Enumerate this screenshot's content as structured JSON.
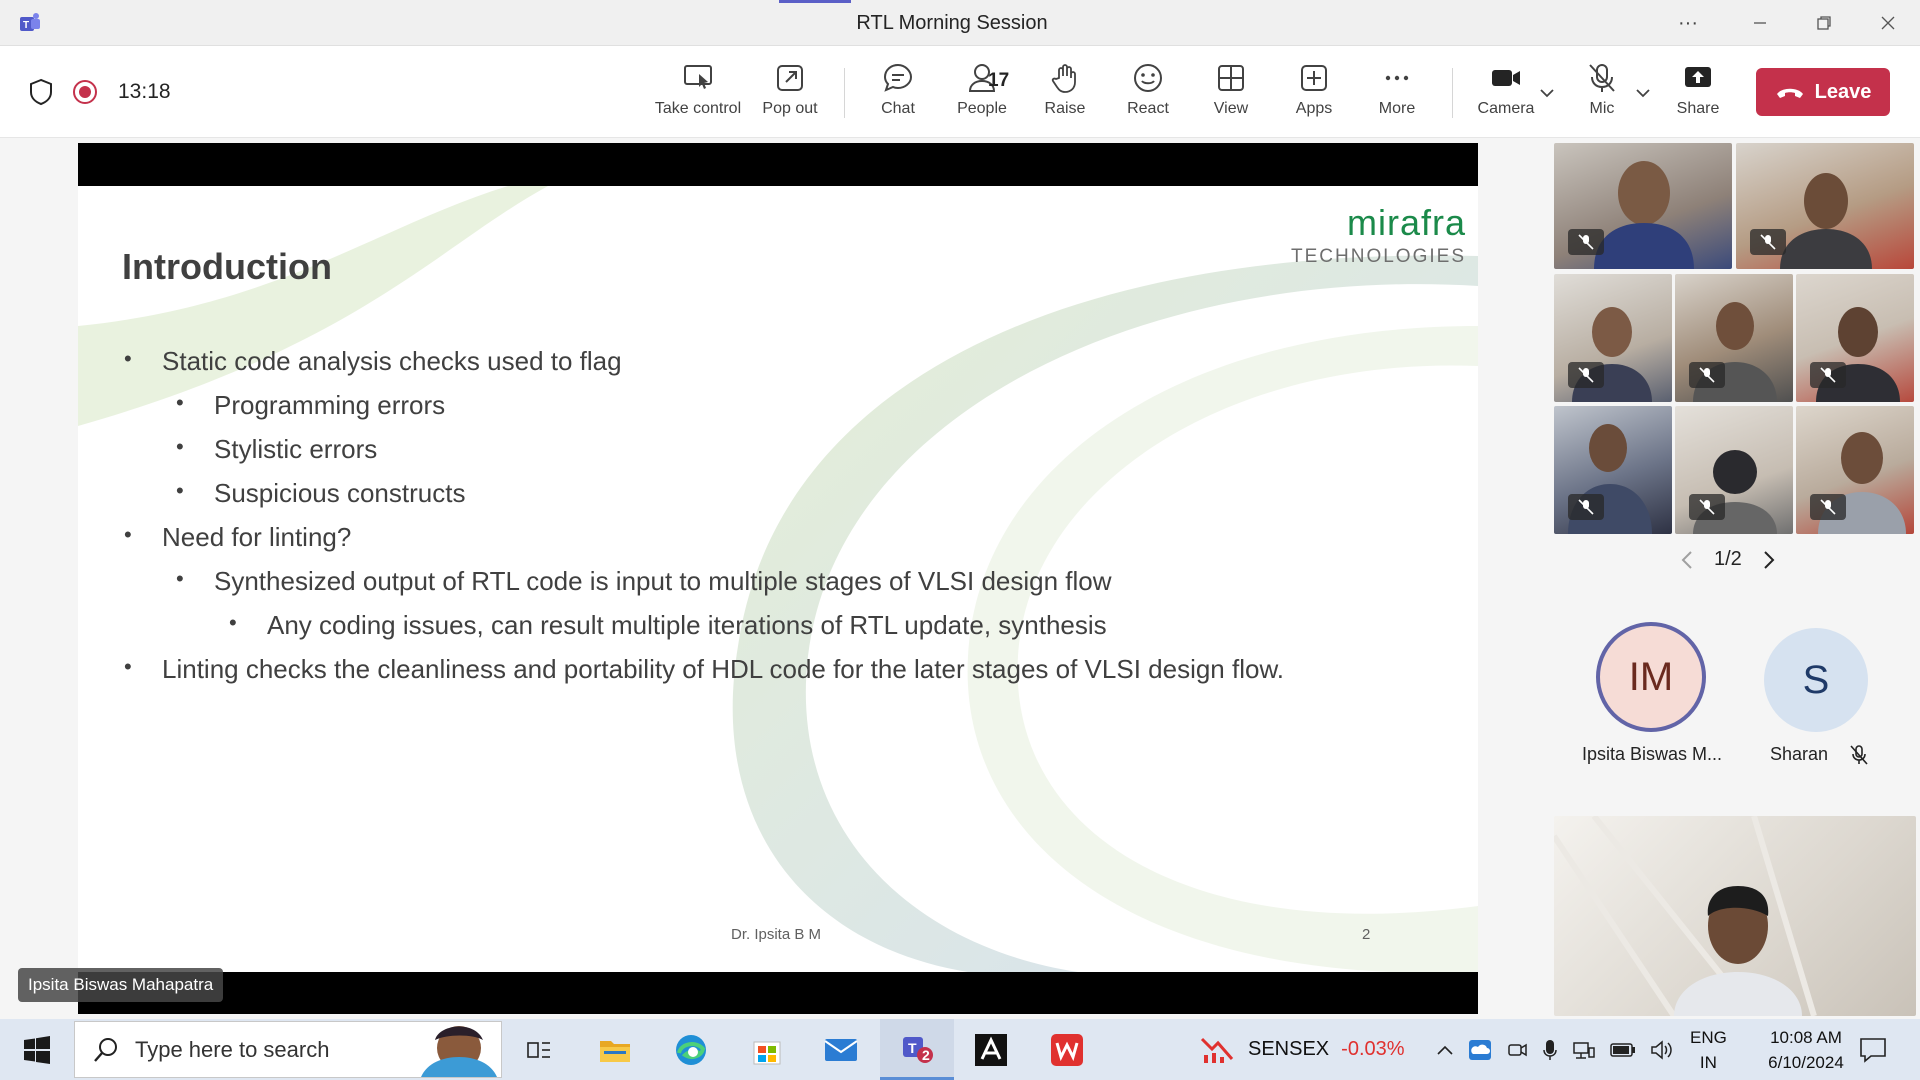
{
  "window": {
    "title": "RTL Morning Session"
  },
  "call": {
    "elapsed": "13:18",
    "people_count": "17"
  },
  "toolbar": {
    "take_control": "Take control",
    "pop_out": "Pop out",
    "chat": "Chat",
    "people": "People",
    "raise": "Raise",
    "react": "React",
    "view": "View",
    "apps": "Apps",
    "more": "More",
    "camera": "Camera",
    "mic": "Mic",
    "share": "Share",
    "leave": "Leave"
  },
  "slide": {
    "title": "Introduction",
    "brand_name": "mirafra",
    "brand_sub": "TECHNOLOGIES",
    "bullets": [
      "Static code analysis checks used to flag",
      "Programming errors",
      "Stylistic errors",
      "Suspicious constructs",
      "Need for linting?",
      "Synthesized output of RTL code is input to multiple stages of VLSI design flow",
      "Any coding issues, can result multiple iterations of RTL update, synthesis",
      "Linting checks the cleanliness and portability of HDL code for the later stages of VLSI design flow."
    ],
    "footer_author": "Dr. Ipsita B M",
    "page_number": "2"
  },
  "presenter": {
    "name": "Ipsita Biswas Mahapatra"
  },
  "gallery": {
    "page": "1/2",
    "participants": [
      {
        "initials": "IM",
        "name": "Ipsita Biswas M..."
      },
      {
        "initials": "S",
        "name": "Sharan"
      }
    ]
  },
  "taskbar": {
    "search_placeholder": "Type here to search",
    "teams_badge": "2",
    "stock_name": "SENSEX",
    "stock_change": "-0.03%",
    "lang_top": "ENG",
    "lang_bottom": "IN",
    "time": "10:08 AM",
    "date": "6/10/2024"
  },
  "colors": {
    "accent": "#5b5fc7",
    "leave": "#c4314b",
    "brand_green": "#1b8a4a",
    "stock_negative": "#e0312f"
  }
}
